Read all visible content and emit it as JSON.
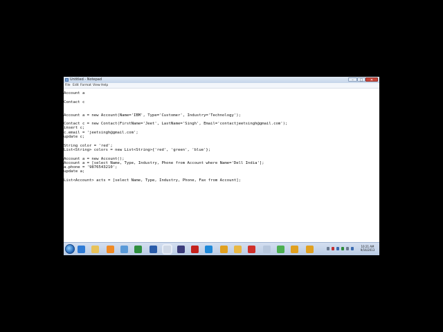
{
  "window": {
    "title": "Untitled - Notepad",
    "minimize_glyph": "–",
    "maximize_glyph": "□",
    "close_glyph": "✕"
  },
  "menu": {
    "file": "File",
    "edit": "Edit",
    "format": "Format",
    "view": "View",
    "help": "Help"
  },
  "editor": {
    "lines": [
      "Account a",
      "",
      "Contact c",
      "",
      "",
      "Account a = new Account(Name='IBM', Type='Customer', Industry='Technology');",
      "",
      "Contact c = new Contact(FirstName='Jeet', LastName='Singh', Email='contactjeetsingh@gmail.com');",
      "insert c;",
      "c.email = 'jeetsingh@gmail.com';",
      "update c;",
      "",
      "String color = 'red';",
      "List<String> colors = new List<String>{'red', 'green', 'blue'};",
      "",
      "Account a = new Account();",
      "Account a = [select Name, Type, Industry, Phone from Account where Name='Dell India'];",
      "a.phone = '9876543210';",
      "update a;",
      "",
      "List<Account> acts = [select Name, Type, Industry, Phone, Fax from Account];"
    ]
  },
  "taskbar": {
    "icons": [
      {
        "name": "ie",
        "color": "#2e7bd6"
      },
      {
        "name": "explorer",
        "color": "#e8c25a"
      },
      {
        "name": "media-player",
        "color": "#f08a24"
      },
      {
        "name": "network",
        "color": "#5a9ad8"
      },
      {
        "name": "excel",
        "color": "#2f8f3f"
      },
      {
        "name": "outlook",
        "color": "#2a5caa"
      },
      {
        "name": "notepad",
        "color": "#cfd8e6"
      },
      {
        "name": "eclipse",
        "color": "#3b3b7a"
      },
      {
        "name": "acrobat",
        "color": "#c4221d"
      },
      {
        "name": "ie-2",
        "color": "#1e88d8"
      },
      {
        "name": "app-snowflake",
        "color": "#e0a020"
      },
      {
        "name": "folder",
        "color": "#e8b845"
      },
      {
        "name": "acrobat-2",
        "color": "#d0302b"
      },
      {
        "name": "paint",
        "color": "#b7c7dd"
      },
      {
        "name": "chrome",
        "color": "#4caf50"
      },
      {
        "name": "app-snowflake-2",
        "color": "#e0a020"
      },
      {
        "name": "app-snowflake-3",
        "color": "#e0a020"
      }
    ],
    "active_icon": "notepad",
    "tray_colors": [
      "#6a7a90",
      "#c03030",
      "#3a6ab0",
      "#2d8a3a",
      "#6a7a90",
      "#3a6ab0"
    ],
    "clock_time": "10:21 AM",
    "clock_date": "9/16/2013"
  },
  "colors": {
    "titlebar": "#c4d5ea",
    "taskbar": "#b9cbe4",
    "editor_bg": "#ffffff",
    "text": "#111111"
  }
}
